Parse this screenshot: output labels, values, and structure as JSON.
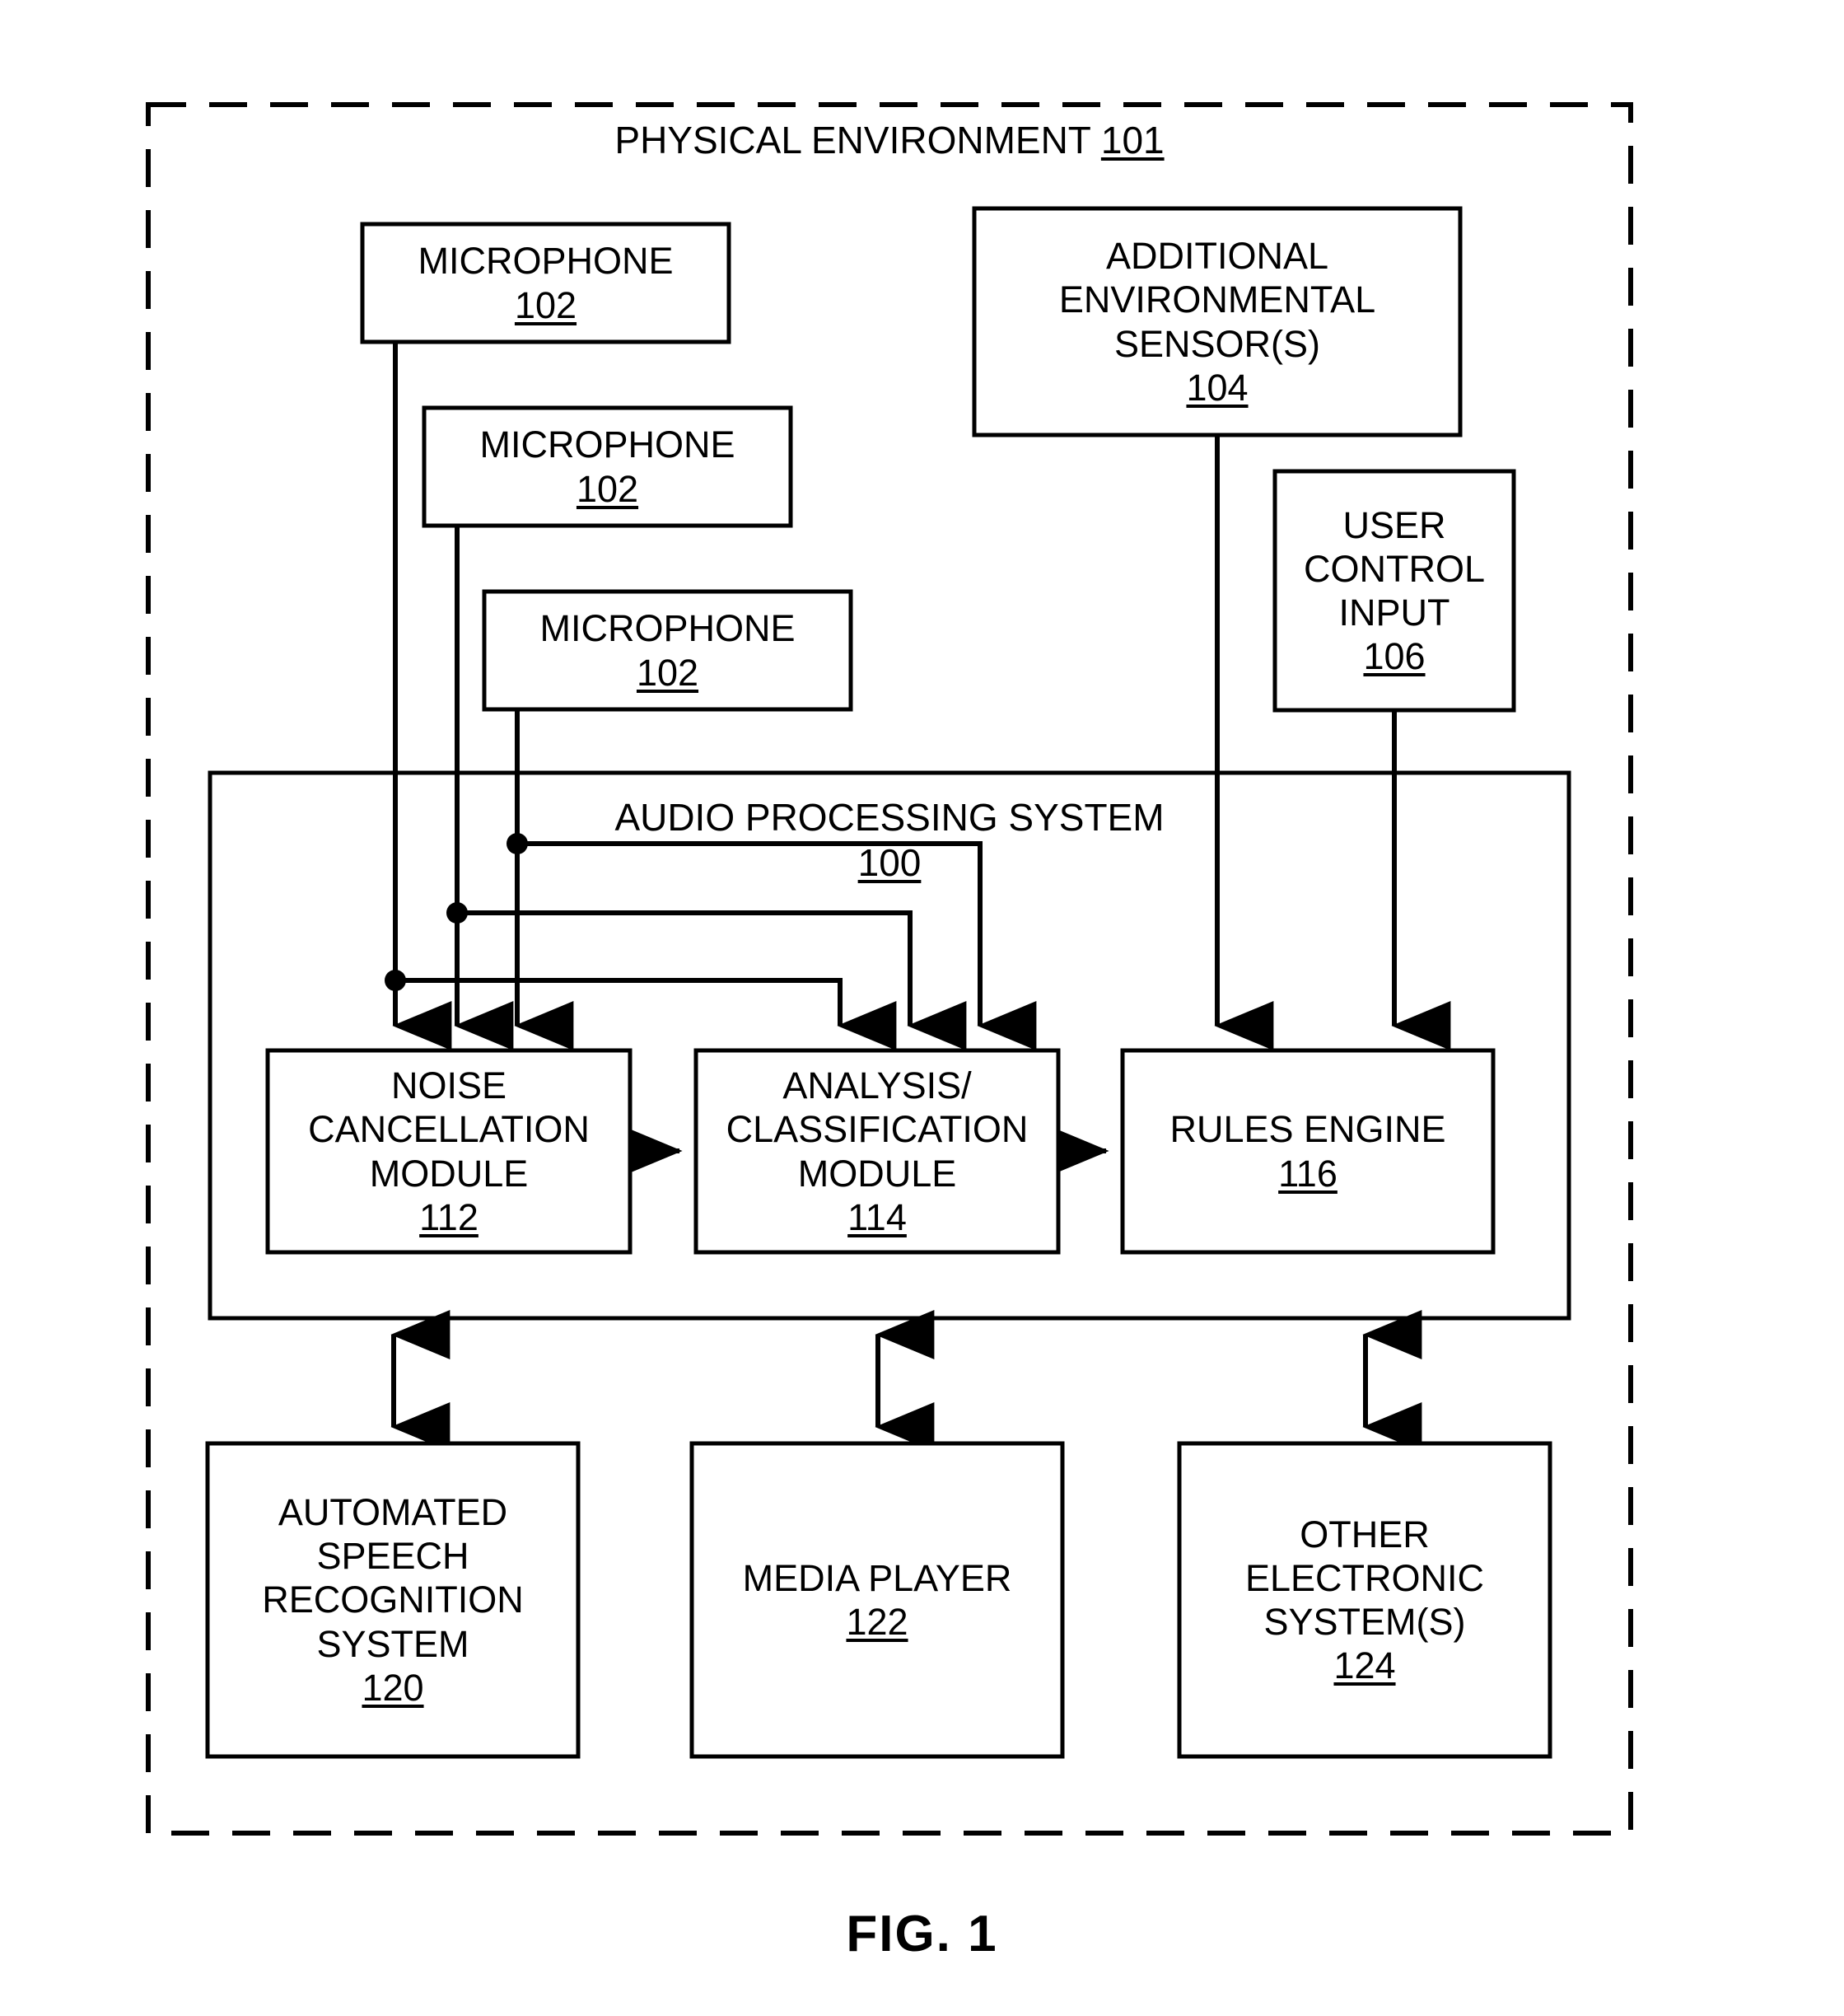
{
  "figure": {
    "caption": "FIG. 1",
    "boundary_label": "PHYSICAL ENVIRONMENT",
    "boundary_ref": "101"
  },
  "blocks": {
    "microphone_1": {
      "title": "MICROPHONE",
      "ref": "102"
    },
    "microphone_2": {
      "title": "MICROPHONE",
      "ref": "102"
    },
    "microphone_3": {
      "title": "MICROPHONE",
      "ref": "102"
    },
    "additional_sensors": {
      "line1": "ADDITIONAL",
      "line2": "ENVIRONMENTAL",
      "line3": "SENSOR(S)",
      "ref": "104"
    },
    "user_control_input": {
      "line1": "USER",
      "line2": "CONTROL",
      "line3": "INPUT",
      "ref": "106"
    },
    "audio_processing_system": {
      "title": "AUDIO PROCESSING SYSTEM",
      "ref": "100"
    },
    "noise_cancellation_module": {
      "line1": "NOISE",
      "line2": "CANCELLATION",
      "line3": "MODULE",
      "ref": "112"
    },
    "analysis_classification_module": {
      "line1": "ANALYSIS/",
      "line2": "CLASSIFICATION",
      "line3": "MODULE",
      "ref": "114"
    },
    "rules_engine": {
      "title": "RULES ENGINE",
      "ref": "116"
    },
    "asr_system": {
      "line1": "AUTOMATED",
      "line2": "SPEECH",
      "line3": "RECOGNITION",
      "line4": "SYSTEM",
      "ref": "120"
    },
    "media_player": {
      "title": "MEDIA PLAYER",
      "ref": "122"
    },
    "other_electronic_systems": {
      "line1": "OTHER",
      "line2": "ELECTRONIC",
      "line3": "SYSTEM(S)",
      "ref": "124"
    }
  },
  "colors": {
    "stroke": "#000000",
    "fill": "#ffffff",
    "text": "#000000"
  }
}
